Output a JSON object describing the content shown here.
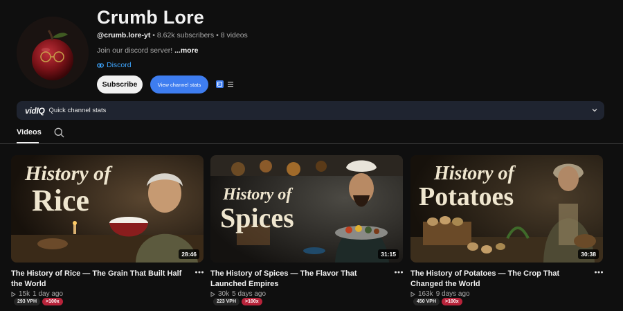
{
  "channel": {
    "title": "Crumb Lore",
    "handle": "@crumb.lore-yt",
    "subscribers": "8.62k subscribers",
    "video_count": "8 videos",
    "separator": "•",
    "description": "Join our discord server!",
    "more_label": "...more",
    "link_label": "Discord"
  },
  "actions": {
    "subscribe_label": "Subscribe",
    "stats_label": "View channel stats"
  },
  "stats_bar": {
    "logo_vid": "vid",
    "logo_iq": "IQ",
    "label": "Quick channel stats"
  },
  "tabs": {
    "videos_label": "Videos"
  },
  "videos": [
    {
      "thumb_line1": "History of",
      "thumb_line2": "Rice",
      "duration": "28:46",
      "title": "The History of Rice — The Grain That Built Half the World",
      "views": "15k",
      "age": "1 day ago",
      "vph": "293 VPH",
      "multiplier": ">100x"
    },
    {
      "thumb_line1": "History of",
      "thumb_line2": "Spices",
      "duration": "31:15",
      "title": "The History of Spices — The Flavor That Launched Empires",
      "views": "30k",
      "age": "5 days ago",
      "vph": "223 VPH",
      "multiplier": ">100x"
    },
    {
      "thumb_line1": "History of",
      "thumb_line2": "Potatoes",
      "duration": "30:38",
      "title": "The History of Potatoes — The Crop That Changed the World",
      "views": "163k",
      "age": "9 days ago",
      "vph": "450 VPH",
      "multiplier": ">100x"
    }
  ],
  "colors": {
    "background": "#0f0f0f",
    "accent_blue": "#3e7df0",
    "link_blue": "#3ea6ff",
    "badge_red": "#b8233a",
    "thumb_text": "#efe6cf"
  },
  "icons": {
    "link": "link-icon",
    "search": "search-icon",
    "chevron": "chevron-down-icon",
    "more": "more-vert-icon",
    "play": "play-icon",
    "menu": "menu-icon"
  }
}
